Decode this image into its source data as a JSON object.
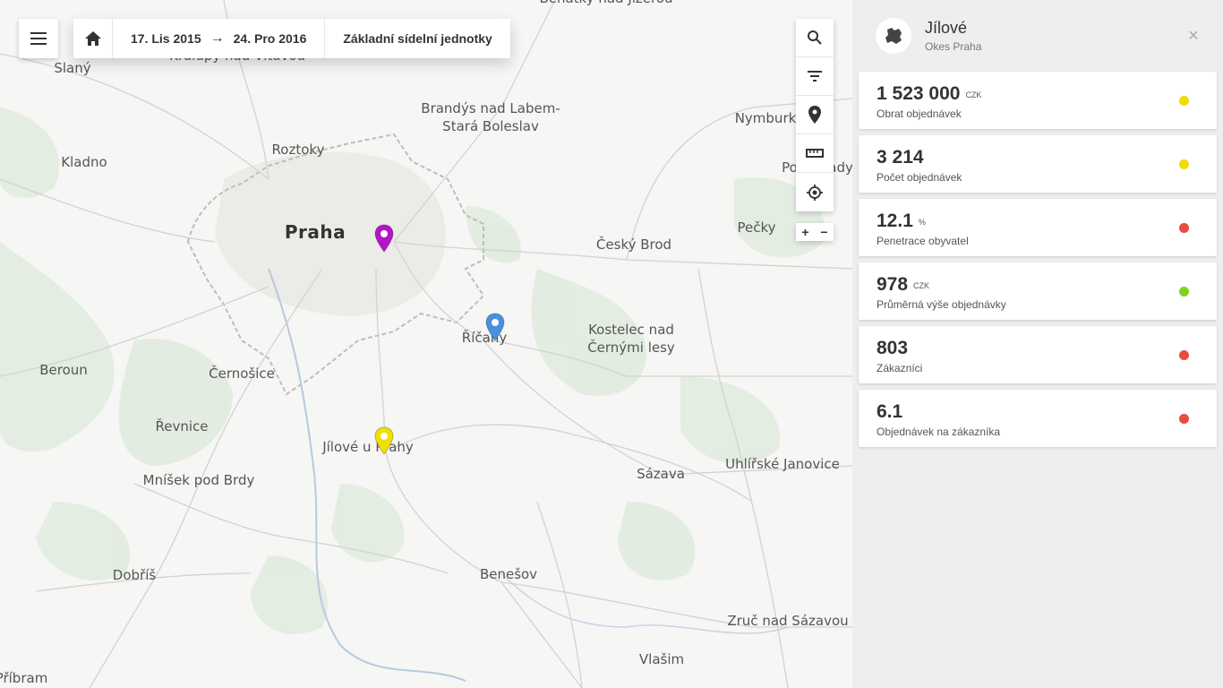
{
  "toolbar": {
    "menu_icon": "hamburger-menu-icon",
    "home_icon": "home-icon",
    "date_from": "17. Lis 2015",
    "arrow": "→",
    "date_to": "24. Pro 2016",
    "units_label": "Základní sídelní jednotky"
  },
  "tools": {
    "items": [
      "search-icon",
      "filter-icon",
      "location-pin-icon",
      "ruler-icon",
      "crosshair-locate-icon"
    ],
    "zoom_in": "+",
    "zoom_out": "−"
  },
  "map": {
    "cities": [
      {
        "name": "Benátky nad Jizerou"
      },
      {
        "name": "Kralupy nad Vltavou"
      },
      {
        "name": "Slaný"
      },
      {
        "name": "Brandýs nad Labem-\nStará Boleslav"
      },
      {
        "name": "Nymburk"
      },
      {
        "name": "Roztoky"
      },
      {
        "name": "Kladno"
      },
      {
        "name": "Poděbrady"
      },
      {
        "name": "Praha"
      },
      {
        "name": "Český Brod"
      },
      {
        "name": "Pečky"
      },
      {
        "name": "Říčany"
      },
      {
        "name": "Kostelec nad\nČernými lesy"
      },
      {
        "name": "Beroun"
      },
      {
        "name": "Černošice"
      },
      {
        "name": "Řevnice"
      },
      {
        "name": "Jílové u Prahy"
      },
      {
        "name": "Sázava"
      },
      {
        "name": "Uhlířské Janovice"
      },
      {
        "name": "Mníšek pod Brdy"
      },
      {
        "name": "Dobříš"
      },
      {
        "name": "Benešov"
      },
      {
        "name": "Zruč nad Sázavou"
      },
      {
        "name": "Vlašim"
      },
      {
        "name": "Příbram"
      }
    ],
    "markers": [
      {
        "name": "marker-praha",
        "color": "#b414c8"
      },
      {
        "name": "marker-ricany",
        "color": "#4a8fe0"
      },
      {
        "name": "marker-jilove",
        "color": "#f0e000"
      }
    ]
  },
  "panel": {
    "region_icon": "region-shape-icon",
    "region_name": "Jílové",
    "region_sub": "Okes Praha",
    "close": "×",
    "cards": [
      {
        "value": "1 523 000",
        "unit": "CZK",
        "label": "Obrat objednávek",
        "status": "#f0dc00"
      },
      {
        "value": "3 214",
        "unit": "",
        "label": "Počet objednávek",
        "status": "#f0dc00"
      },
      {
        "value": "12.1",
        "unit": "%",
        "label": "Penetrace obyvatel",
        "status": "#e84c3d"
      },
      {
        "value": "978",
        "unit": "CZK",
        "label": "Průměrná výše objednávky",
        "status": "#7ed321"
      },
      {
        "value": "803",
        "unit": "",
        "label": "Zákazníci",
        "status": "#e84c3d"
      },
      {
        "value": "6.1",
        "unit": "",
        "label": "Objednávek na zákazníka",
        "status": "#e84c3d"
      }
    ]
  }
}
